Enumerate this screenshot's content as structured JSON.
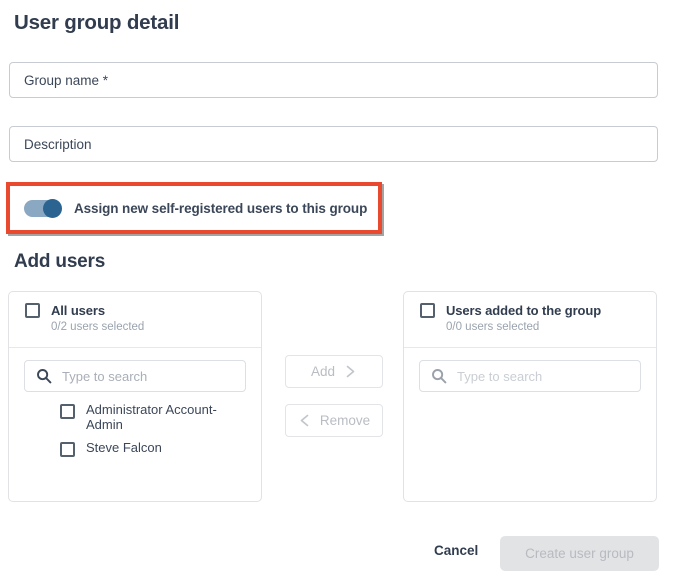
{
  "page": {
    "title": "User group detail",
    "section_title": "Add users"
  },
  "form": {
    "group_name_placeholder": "Group name *",
    "description_placeholder": "Description"
  },
  "toggle": {
    "label": "Assign new self-registered users to this group",
    "state": "on",
    "track_color": "#8aa8c2",
    "knob_color": "#2b6491",
    "highlight_color": "#e8492f"
  },
  "all_users_panel": {
    "title": "All users",
    "subtitle": "0/2 users selected",
    "search_placeholder": "Type to search",
    "search_icon": "search-icon",
    "users": [
      {
        "name": "Administrator Account-Admin"
      },
      {
        "name": "Steve Falcon"
      }
    ]
  },
  "transfer": {
    "add_label": "Add",
    "add_icon": "chevron-right-icon",
    "remove_label": "Remove",
    "remove_icon": "chevron-left-icon"
  },
  "added_users_panel": {
    "title": "Users added to the group",
    "subtitle": "0/0 users selected",
    "search_placeholder": "Type to search",
    "search_icon": "search-icon",
    "users": []
  },
  "footer": {
    "cancel_label": "Cancel",
    "create_label": "Create user group"
  }
}
